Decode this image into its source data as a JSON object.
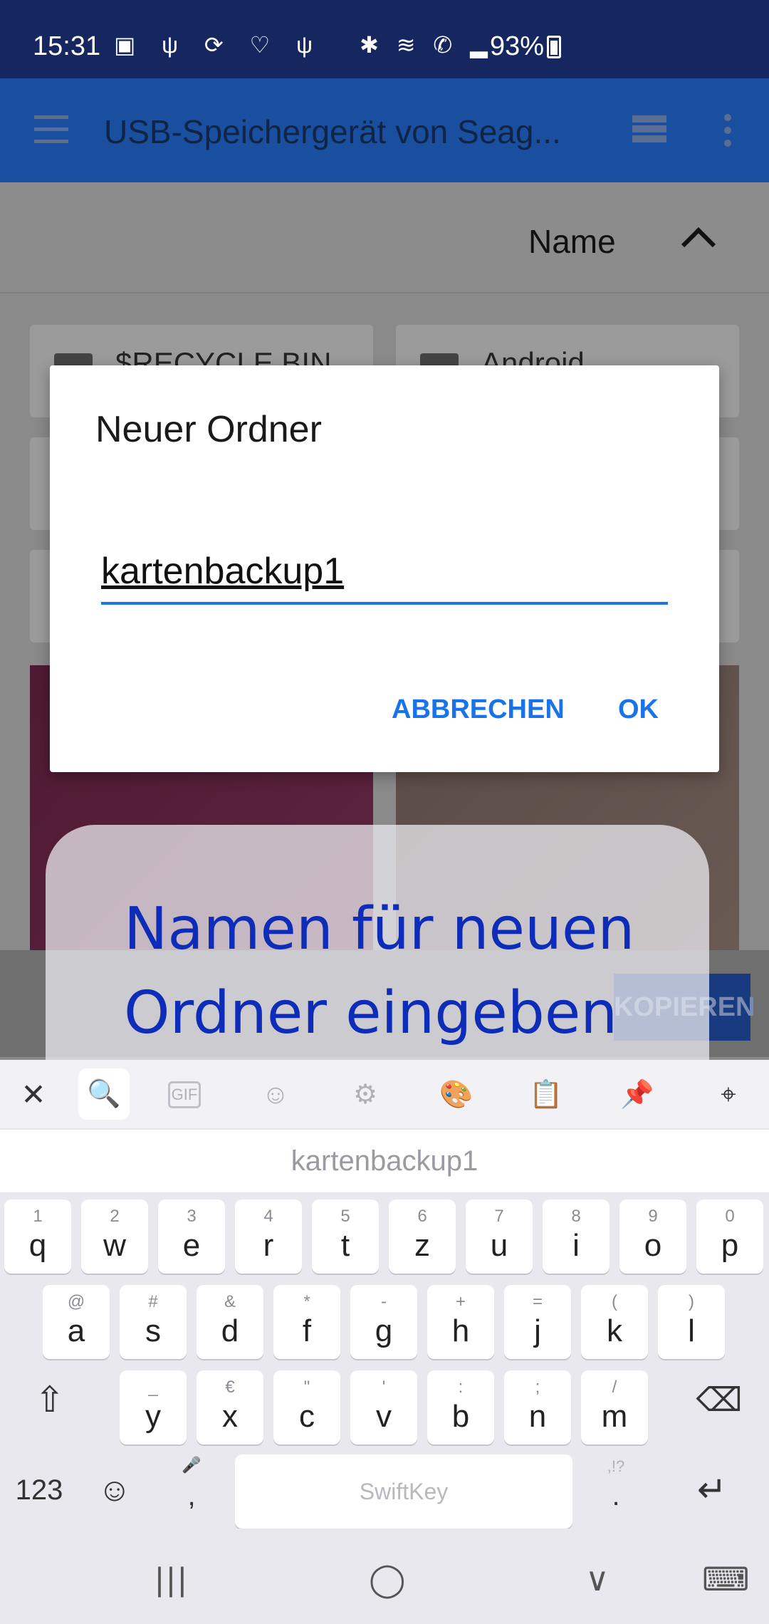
{
  "status_bar": {
    "time": "15:31",
    "notif_icons": "▣ ψ ⟳ ♡ ψ",
    "system_icons": "✱ ≋ ✆ ▂",
    "battery_text": "93%"
  },
  "app_bar": {
    "title": "USB-Speichergerät von Seag..."
  },
  "sort_bar": {
    "label": "Name"
  },
  "background": {
    "card_labels": [
      "$RECYCLE.BIN",
      "Android"
    ],
    "kopieren_label": "KOPIEREN"
  },
  "dialog": {
    "title": "Neuer Ordner",
    "input_value": "kartenbackup1",
    "cancel_label": "ABBRECHEN",
    "ok_label": "OK"
  },
  "tooltip": {
    "text": "Namen für neuen Ordner eingeben"
  },
  "keyboard_toolbar": {
    "close": "✕",
    "search": "🔍",
    "gif": "GIF",
    "sticker": "☺",
    "settings": "⚙",
    "theme": "🎨",
    "clipboard": "📋",
    "pin": "📌",
    "location": "⌖"
  },
  "suggestion": {
    "text": "kartenbackup1"
  },
  "keyboard": {
    "row1": [
      {
        "main": "q",
        "alt": "1"
      },
      {
        "main": "w",
        "alt": "2"
      },
      {
        "main": "e",
        "alt": "3"
      },
      {
        "main": "r",
        "alt": "4"
      },
      {
        "main": "t",
        "alt": "5"
      },
      {
        "main": "z",
        "alt": "6"
      },
      {
        "main": "u",
        "alt": "7"
      },
      {
        "main": "i",
        "alt": "8"
      },
      {
        "main": "o",
        "alt": "9"
      },
      {
        "main": "p",
        "alt": "0"
      }
    ],
    "row2": [
      {
        "main": "a",
        "alt": "@"
      },
      {
        "main": "s",
        "alt": "#"
      },
      {
        "main": "d",
        "alt": "&"
      },
      {
        "main": "f",
        "alt": "*"
      },
      {
        "main": "g",
        "alt": "-"
      },
      {
        "main": "h",
        "alt": "+"
      },
      {
        "main": "j",
        "alt": "="
      },
      {
        "main": "k",
        "alt": "("
      },
      {
        "main": "l",
        "alt": ")"
      }
    ],
    "row3": [
      {
        "main": "y",
        "alt": "_"
      },
      {
        "main": "x",
        "alt": "€"
      },
      {
        "main": "c",
        "alt": "\""
      },
      {
        "main": "v",
        "alt": "'"
      },
      {
        "main": "b",
        "alt": ":"
      },
      {
        "main": "n",
        "alt": ";"
      },
      {
        "main": "m",
        "alt": "/"
      }
    ],
    "shift": "⇧",
    "backspace": "⌫",
    "numbers": "123",
    "emoji": "☺",
    "comma": ",",
    "mic": "🎤",
    "space_label": "SwiftKey",
    "period": ".",
    "period_alt": ",!?",
    "enter": "↵"
  },
  "nav_bar": {
    "recents": "|||",
    "home": "◯",
    "back": "∨",
    "keyboard": "⌨"
  },
  "colors": {
    "status_bar": "#15275e",
    "app_bar": "#1a4fa0",
    "accent": "#1a73e8",
    "tooltip_text": "#0d2cb8"
  }
}
